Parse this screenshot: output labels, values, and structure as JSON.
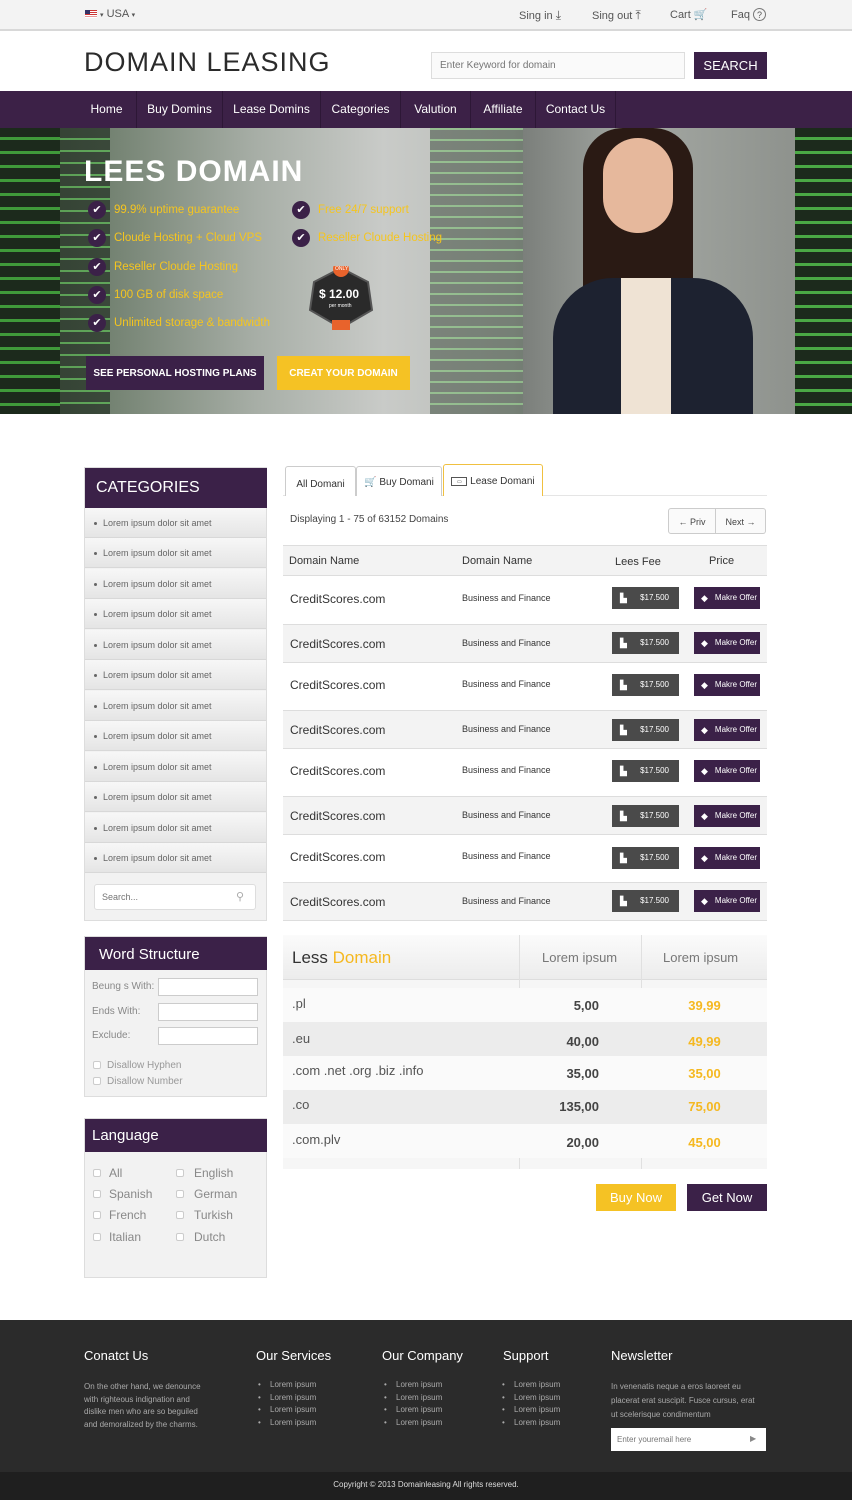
{
  "topbar": {
    "country": "USA",
    "sign_in": "Sing in",
    "sign_out": "Sing out",
    "cart": "Cart",
    "faq": "Faq"
  },
  "header": {
    "logo": "DOMAIN LEASING",
    "search_placeholder": "Enter Keyword for domain",
    "search_button": "SEARCH"
  },
  "nav": [
    "Home",
    "Buy Domins",
    "Lease Domins",
    "Categories",
    "Valution",
    "Affiliate",
    "Contact Us"
  ],
  "hero": {
    "title": "LEES DOMAIN",
    "features_left": [
      "99.9% uptime guarantee",
      "Cloude Hosting + Cloud VPS",
      "Reseller Cloude Hosting",
      "100 GB of disk space",
      "Unlimited storage & bandwidth"
    ],
    "features_right": [
      "Free 24/7 support",
      "Reseller Cloude Hosting"
    ],
    "badge_top": "ONLY",
    "badge_price": "$ 12.00",
    "badge_period": "per month",
    "btn_plans": "SEE PERSONAL HOSTING PLANS",
    "btn_create": "CREAT YOUR DOMAIN"
  },
  "categories": {
    "title": "CATEGORIES",
    "items": [
      "Lorem ipsum dolor sit amet",
      "Lorem ipsum dolor sit amet",
      "Lorem ipsum dolor sit amet",
      "Lorem ipsum dolor sit amet",
      "Lorem ipsum dolor sit amet",
      "Lorem ipsum dolor sit amet",
      "Lorem ipsum dolor sit amet",
      "Lorem ipsum dolor sit amet",
      "Lorem ipsum dolor sit amet",
      "Lorem ipsum dolor sit amet",
      "Lorem ipsum dolor sit amet",
      "Lorem ipsum dolor sit amet"
    ],
    "search_placeholder": "Search..."
  },
  "word_structure": {
    "title": "Word Structure",
    "begins_with": "Beung s With:",
    "ends_with": "Ends With:",
    "exclude": "Exclude:",
    "disallow_hyphen": "Disallow Hyphen",
    "disallow_number": "Disallow Number"
  },
  "language": {
    "title": "Language",
    "left": [
      "All",
      "Spanish",
      "French",
      "Italian"
    ],
    "right": [
      "English",
      "German",
      "Turkish",
      "Dutch"
    ]
  },
  "tabs": [
    "All Domani",
    "Buy Domani",
    "Lease Domani"
  ],
  "listing": {
    "displaying": "Displaying 1 - 75 of 63152 Domains",
    "prev": "Priv",
    "next": "Next",
    "headers": [
      "Domain Name",
      "Domain Name",
      "Lees Fee",
      "Price"
    ],
    "rows": [
      {
        "domain": "CreditScores.com",
        "category": "Business and Finance",
        "fee": "$17.500",
        "offer": "Makre Offer"
      },
      {
        "domain": "CreditScores.com",
        "category": "Business and Finance",
        "fee": "$17.500",
        "offer": "Makre Offer"
      },
      {
        "domain": "CreditScores.com",
        "category": "Business and Finance",
        "fee": "$17.500",
        "offer": "Makre Offer"
      },
      {
        "domain": "CreditScores.com",
        "category": "Business and Finance",
        "fee": "$17.500",
        "offer": "Makre Offer"
      },
      {
        "domain": "CreditScores.com",
        "category": "Business and Finance",
        "fee": "$17.500",
        "offer": "Makre Offer"
      },
      {
        "domain": "CreditScores.com",
        "category": "Business and Finance",
        "fee": "$17.500",
        "offer": "Makre Offer"
      },
      {
        "domain": "CreditScores.com",
        "category": "Business and Finance",
        "fee": "$17.500",
        "offer": "Makre Offer"
      },
      {
        "domain": "CreditScores.com",
        "category": "Business and Finance",
        "fee": "$17.500",
        "offer": "Makre Offer"
      }
    ]
  },
  "pricing": {
    "title_a": "Less",
    "title_b": "Domain",
    "col1": "Lorem ipsum",
    "col2": "Lorem ipsum",
    "rows": [
      {
        "tld": ".pl",
        "a": "5,00",
        "b": "39,99"
      },
      {
        "tld": ".eu",
        "a": "40,00",
        "b": "49,99"
      },
      {
        "tld": ".com .net .org .biz .info",
        "a": "35,00",
        "b": "35,00"
      },
      {
        "tld": ".co",
        "a": "135,00",
        "b": "75,00"
      },
      {
        "tld": ".com.plv",
        "a": "20,00",
        "b": "45,00"
      }
    ],
    "buy_now": "Buy Now",
    "get_now": "Get Now"
  },
  "footer": {
    "contact_title": "Conatct Us",
    "contact_text": [
      "On the other hand, we denounce",
      "with righteous indignation and",
      "dislike men who are so beguiled",
      "and demoralized by the charms."
    ],
    "services_title": "Our Services",
    "company_title": "Our Company",
    "support_title": "Support",
    "newsletter_title": "Newsletter",
    "link": "Lorem ipsum",
    "newsletter_text": [
      "In venenatis neque a eros laoreet eu",
      "placerat erat suscipit. Fusce cursus, erat",
      "ut scelerisque condimentum"
    ],
    "newsletter_placeholder": "Enter youremail here",
    "copyright": "Copyright © 2013 Domainleasing All rights reserved."
  },
  "colors": {
    "brand_purple": "#3b2148",
    "accent_yellow": "#f5c224",
    "footer_bg": "#2b2b2b"
  }
}
